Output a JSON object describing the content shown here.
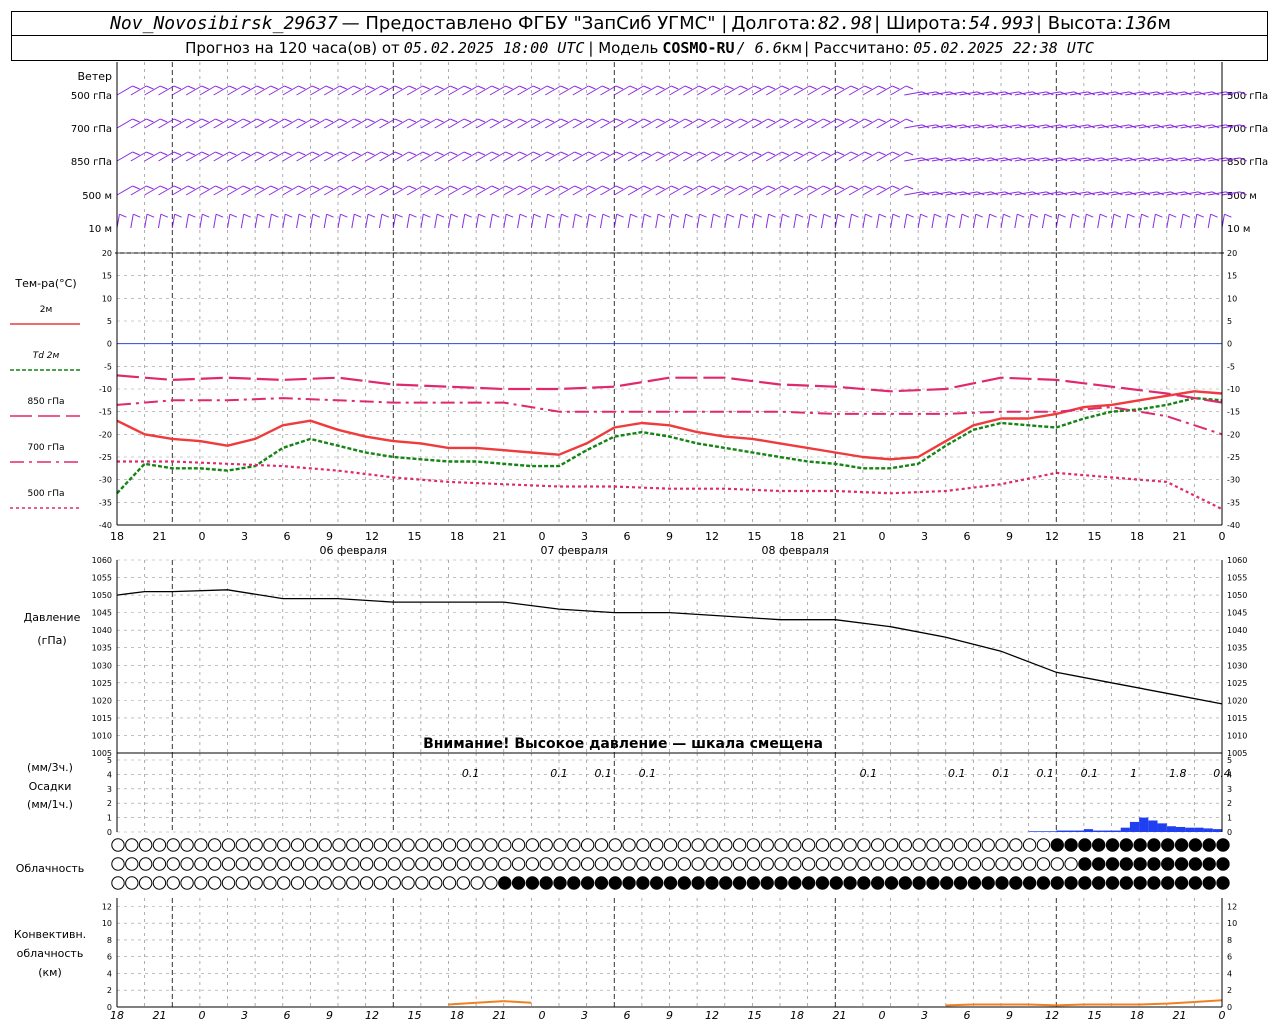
{
  "header": {
    "station": "Nov_Novosibirsk_29637",
    "provider": "— Предоставлено ФГБУ \"ЗапСиб УГМС\" |",
    "lon_label": "Долгота:",
    "lon": "82.98",
    "lat_label": "| Широта:",
    "lat": "54.993",
    "alt_label": "| Высота:",
    "alt": "136",
    "alt_unit": "м",
    "forecast_label": "Прогноз на 120 часа(ов) от",
    "forecast_time": "05.02.2025 18:00 UTC",
    "model_label": "| Модель",
    "model": "COSMO-RU",
    "model_res": "/ 6.6",
    "model_res_unit": "км",
    "calc_label": "| Рассчитано:",
    "calc_time": "05.02.2025 22:38 UTC"
  },
  "chart_data": {
    "type": "line",
    "x_hour_labels": [
      "18",
      "21",
      "0",
      "3",
      "6",
      "9",
      "12",
      "15",
      "18",
      "21",
      "0",
      "3",
      "6",
      "9",
      "12",
      "15",
      "18",
      "21",
      "0",
      "3",
      "6",
      "9",
      "12",
      "15",
      "18",
      "21",
      "0"
    ],
    "day_labels": [
      "06 февраля",
      "07 февраля",
      "08 февраля"
    ],
    "wind": {
      "title": "Ветер",
      "levels": [
        "500 гПа",
        "700 гПа",
        "850 гПа",
        "500 м",
        "10 м"
      ]
    },
    "temperature": {
      "title": "Тем-ра(°C)",
      "ylim": [
        -40,
        20
      ],
      "yticks": [
        20,
        15,
        10,
        5,
        0,
        -5,
        -10,
        -15,
        -20,
        -25,
        -30,
        -35,
        -40
      ],
      "legend": [
        {
          "name": "2м",
          "color": "#ef3b3b",
          "dash": ""
        },
        {
          "name": "Td 2м",
          "color": "#148414",
          "dash": "4,2"
        },
        {
          "name": "850 гПа",
          "color": "#e0286e",
          "dash": "22,6"
        },
        {
          "name": "700 гПа",
          "color": "#e0286e",
          "dash": "14,5,3,5"
        },
        {
          "name": "500 гПа",
          "color": "#e0286e",
          "dash": "3,3"
        }
      ],
      "series": [
        {
          "name": "2м",
          "x": [
            0,
            3,
            6,
            9,
            12,
            15,
            18,
            21,
            24,
            27,
            30,
            33,
            36,
            39,
            42,
            45,
            48,
            51,
            54,
            57,
            60,
            63,
            66,
            69,
            72,
            75,
            78,
            81,
            84,
            87,
            90,
            93,
            96,
            99,
            102,
            105,
            108,
            111,
            114,
            117,
            120
          ],
          "values": [
            -17,
            -20,
            -21,
            -21.5,
            -22.5,
            -21,
            -18,
            -17,
            -19,
            -20.5,
            -21.5,
            -22,
            -23,
            -23,
            -23.5,
            -24,
            -24.5,
            -22,
            -18.5,
            -17.5,
            -18,
            -19.5,
            -20.5,
            -21,
            -22,
            -23,
            -24,
            -25,
            -25.5,
            -25,
            -21.5,
            -18,
            -16.5,
            -16.5,
            -15.5,
            -14,
            -13.5,
            -12.5,
            -11.5,
            -10.5,
            -11
          ]
        },
        {
          "name": "Td 2м",
          "x": [
            0,
            3,
            6,
            9,
            12,
            15,
            18,
            21,
            24,
            27,
            30,
            33,
            36,
            39,
            42,
            45,
            48,
            51,
            54,
            57,
            60,
            63,
            66,
            69,
            72,
            75,
            78,
            81,
            84,
            87,
            90,
            93,
            96,
            99,
            102,
            105,
            108,
            111,
            114,
            117,
            120
          ],
          "values": [
            -33,
            -26.5,
            -27.5,
            -27.5,
            -28,
            -27,
            -23,
            -21,
            -22.5,
            -24,
            -25,
            -25.5,
            -26,
            -26,
            -26.5,
            -27,
            -27,
            -23.5,
            -20.5,
            -19.5,
            -20.5,
            -22,
            -23,
            -24,
            -25,
            -26,
            -26.5,
            -27.5,
            -27.5,
            -26.5,
            -22.5,
            -19,
            -17.5,
            -18,
            -18.5,
            -16.5,
            -15,
            -14.5,
            -13.5,
            -12,
            -12.5
          ]
        },
        {
          "name": "850 гПа",
          "x": [
            0,
            6,
            12,
            18,
            24,
            30,
            36,
            42,
            48,
            54,
            60,
            66,
            72,
            78,
            84,
            90,
            96,
            102,
            108,
            114,
            120
          ],
          "values": [
            -7,
            -8,
            -7.5,
            -8,
            -7.5,
            -9,
            -9.5,
            -10,
            -10,
            -9.5,
            -7.5,
            -7.5,
            -9,
            -9.5,
            -10.5,
            -10,
            -7.5,
            -8,
            -9.5,
            -11,
            -13
          ]
        },
        {
          "name": "700 гПа",
          "x": [
            0,
            6,
            12,
            18,
            24,
            30,
            36,
            42,
            48,
            54,
            60,
            66,
            72,
            78,
            84,
            90,
            96,
            102,
            108,
            114,
            120
          ],
          "values": [
            -13.5,
            -12.5,
            -12.5,
            -12,
            -12.5,
            -13,
            -13,
            -13,
            -15,
            -15,
            -15,
            -15,
            -15,
            -15.5,
            -15.5,
            -15.5,
            -15,
            -15,
            -14,
            -16,
            -20
          ]
        },
        {
          "name": "500 гПа",
          "x": [
            0,
            6,
            12,
            18,
            24,
            30,
            36,
            42,
            48,
            54,
            60,
            66,
            72,
            78,
            84,
            90,
            96,
            102,
            108,
            114,
            120
          ],
          "values": [
            -26,
            -26,
            -26.5,
            -27,
            -28,
            -29.5,
            -30.5,
            -31,
            -31.5,
            -31.5,
            -32,
            -32,
            -32.5,
            -32.5,
            -33,
            -32.5,
            -31,
            -28.5,
            -29.5,
            -30.5,
            -36.5
          ]
        }
      ]
    },
    "pressure": {
      "title": "Давление",
      "unit": "(гПа)",
      "ylim": [
        1005,
        1060
      ],
      "yticks": [
        1060,
        1055,
        1050,
        1045,
        1040,
        1035,
        1030,
        1025,
        1020,
        1015,
        1010,
        1005
      ],
      "warning": "Внимание! Высокое давление — шкала смещена",
      "x": [
        0,
        3,
        6,
        12,
        18,
        24,
        30,
        36,
        42,
        48,
        54,
        60,
        66,
        72,
        78,
        84,
        90,
        96,
        102,
        108,
        114,
        120
      ],
      "values": [
        1050,
        1051,
        1051,
        1051.5,
        1049,
        1049,
        1048,
        1048,
        1048,
        1046,
        1045,
        1045,
        1044,
        1043,
        1043,
        1041,
        1038,
        1034,
        1028,
        1025,
        1022,
        1019
      ]
    },
    "precipitation": {
      "title": "Осадки",
      "unit_3h": "(мм/3ч.)",
      "unit_1h": "(мм/1ч.)",
      "ylim": [
        0,
        5
      ],
      "yticks": [
        5,
        4,
        3,
        2,
        1,
        0
      ],
      "labels": [
        {
          "x": 24,
          "text": "0.1"
        },
        {
          "x": 30,
          "text": "0.1"
        },
        {
          "x": 33,
          "text": "0.1"
        },
        {
          "x": 36,
          "text": "0.1"
        },
        {
          "x": 51,
          "text": "0.1"
        },
        {
          "x": 57,
          "text": "0.1"
        },
        {
          "x": 60,
          "text": "0.1"
        },
        {
          "x": 63,
          "text": "0.1"
        },
        {
          "x": 66,
          "text": "0.1"
        },
        {
          "x": 69,
          "text": "1"
        },
        {
          "x": 72,
          "text": "1.8"
        },
        {
          "x": 75,
          "text": "0.4"
        }
      ],
      "bars_x": [
        99,
        100,
        101,
        102,
        103,
        104,
        105,
        106,
        107,
        108,
        109,
        110,
        111,
        112,
        113,
        114,
        115,
        116,
        117,
        118,
        119
      ],
      "bars_values": [
        0.05,
        0.05,
        0.05,
        0.1,
        0.1,
        0.1,
        0.2,
        0.1,
        0.1,
        0.1,
        0.3,
        0.7,
        1.0,
        0.8,
        0.6,
        0.4,
        0.35,
        0.3,
        0.3,
        0.25,
        0.2
      ]
    },
    "clouds": {
      "title": "Облачность"
    },
    "convective": {
      "title_lines": [
        "Конвективн.",
        "облачность",
        "(км)"
      ],
      "ylim": [
        0,
        13
      ],
      "yticks": [
        12,
        10,
        8,
        6,
        4,
        2,
        0
      ],
      "x": [
        36,
        39,
        42,
        45,
        90,
        93,
        96,
        99,
        102,
        105,
        108,
        111,
        114,
        117,
        120
      ],
      "values": [
        0.3,
        0.5,
        0.7,
        0.5,
        0.2,
        0.3,
        0.3,
        0.3,
        0.2,
        0.3,
        0.3,
        0.3,
        0.4,
        0.6,
        0.8
      ]
    },
    "colors": {
      "wind": "#8a2be2",
      "t2m": "#ef3b3b",
      "td2m": "#148414",
      "upper": "#e0286e",
      "pressure": "#000000",
      "precip": "#1f3ff0",
      "convective": "#f08020",
      "zero_line": "#2b4bd8"
    }
  }
}
